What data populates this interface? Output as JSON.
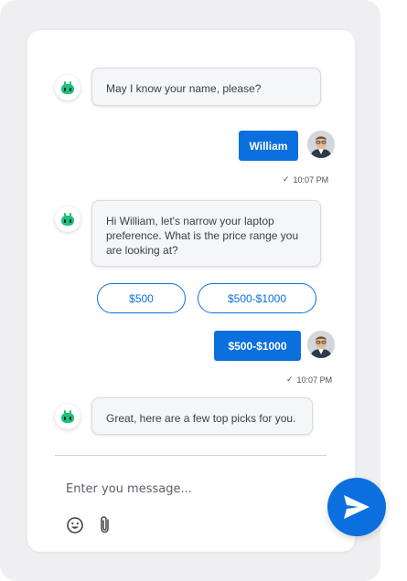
{
  "conversation": {
    "messages": [
      {
        "from": "bot",
        "text": "May I know your name, please?"
      },
      {
        "from": "user",
        "text": "William",
        "time": "10:07 PM"
      },
      {
        "from": "bot",
        "text": "Hi William, let's narrow your laptop preference. What is the price range you are looking at?"
      },
      {
        "from": "user",
        "text": "$500-$1000",
        "time": "10:07 PM"
      },
      {
        "from": "bot",
        "text": "Great, here are a few top picks for you."
      }
    ],
    "price_options": [
      "$500",
      "$500-$1000"
    ]
  },
  "composer": {
    "placeholder": "Enter you message...",
    "emoji_icon": "emoji-icon",
    "attach_icon": "paperclip-icon",
    "send_icon": "send-icon"
  },
  "colors": {
    "accent": "#0b6fde",
    "bot_icon": "#1fc07a",
    "bubble_bg": "#f5f6f8",
    "window_bg": "#efeff1"
  }
}
